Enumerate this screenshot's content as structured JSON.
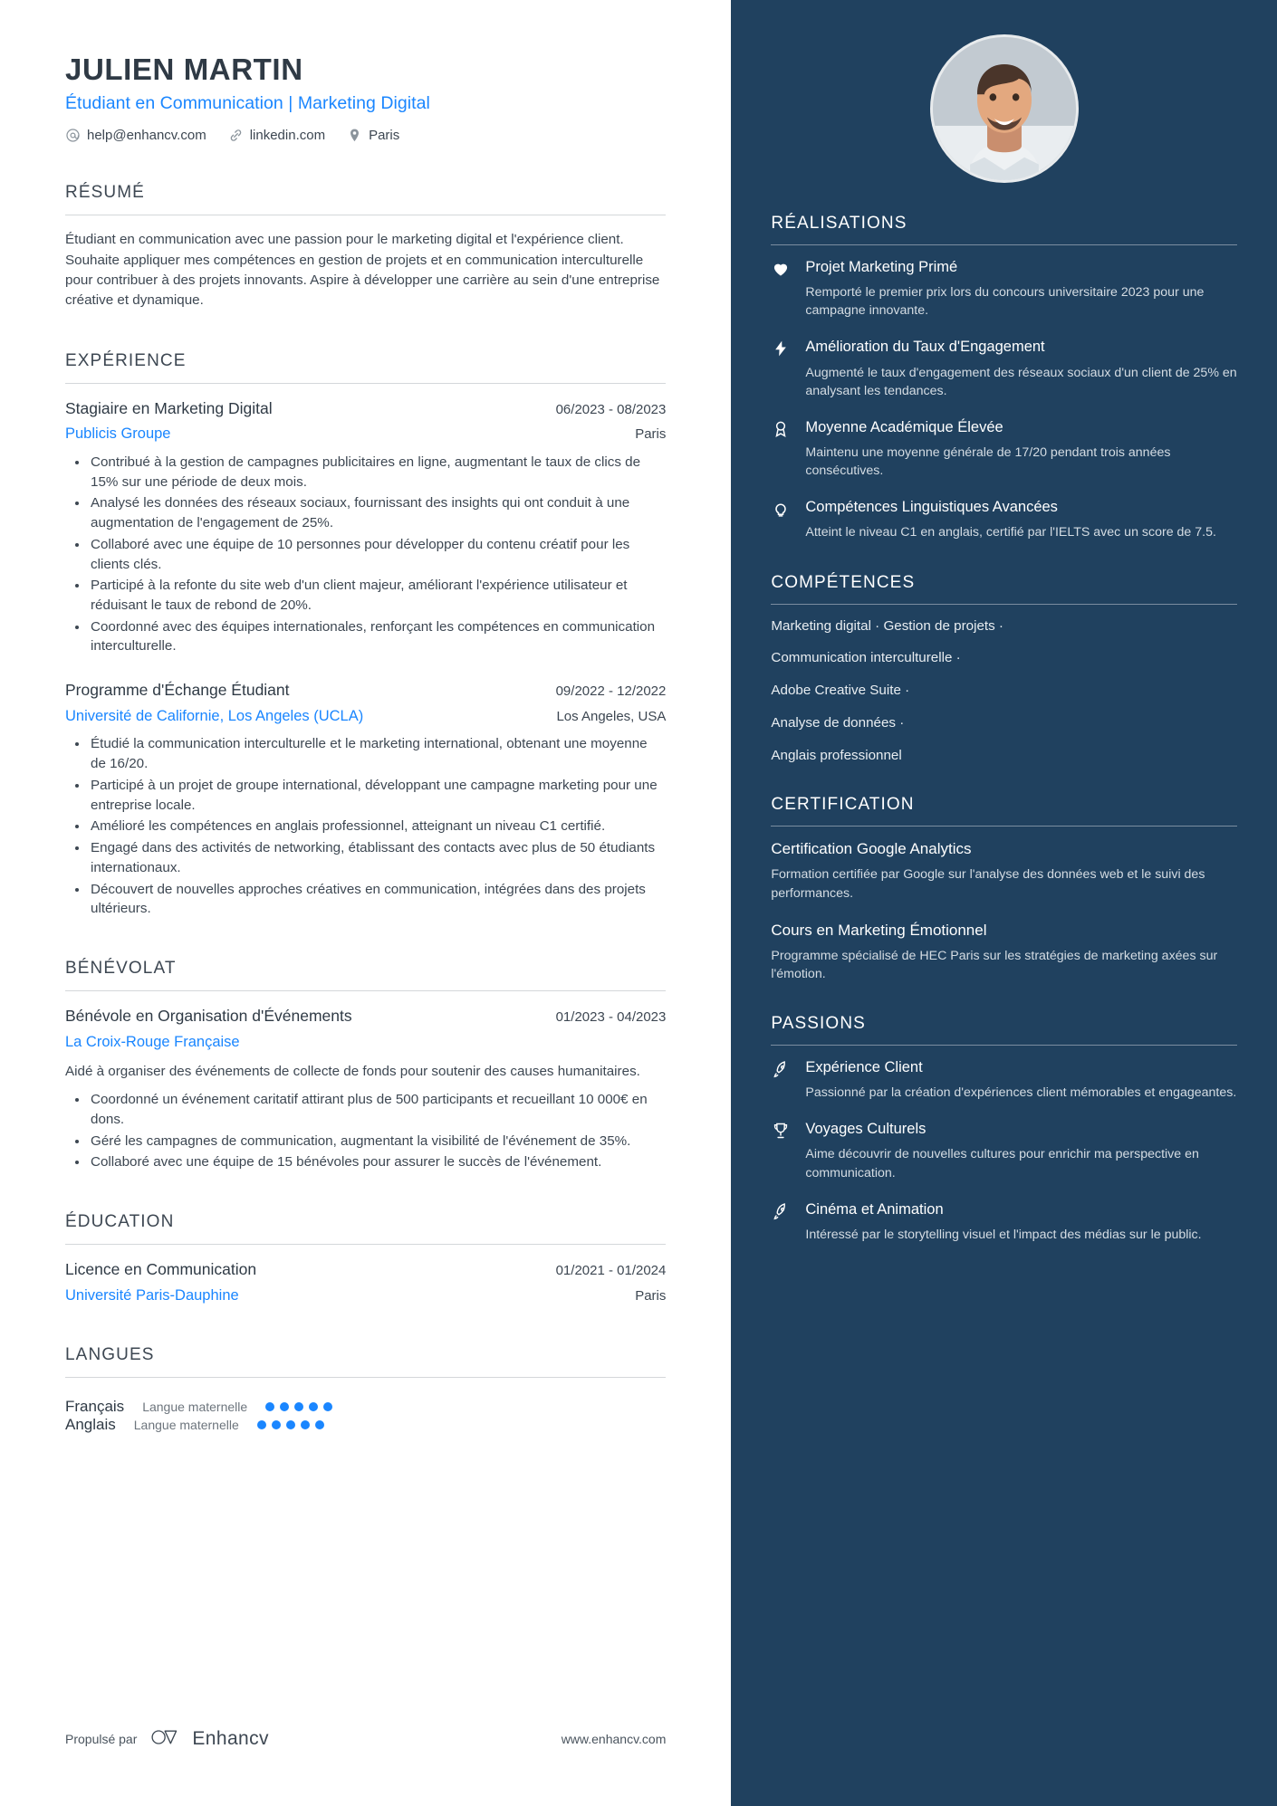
{
  "header": {
    "name": "JULIEN MARTIN",
    "headline": "Étudiant en Communication | Marketing Digital",
    "contacts": [
      {
        "icon": "at-icon",
        "text": "help@enhancv.com"
      },
      {
        "icon": "link-icon",
        "text": "linkedin.com"
      },
      {
        "icon": "location-pin-icon",
        "text": "Paris"
      }
    ]
  },
  "left": {
    "summary": {
      "title": "RÉSUMÉ",
      "text": "Étudiant en communication avec une passion pour le marketing digital et l'expérience client. Souhaite appliquer mes compétences en gestion de projets et en communication interculturelle pour contribuer à des projets innovants. Aspire à développer une carrière au sein d'une entreprise créative et dynamique."
    },
    "experience": {
      "title": "EXPÉRIENCE",
      "entries": [
        {
          "role": "Stagiaire en Marketing Digital",
          "date": "06/2023 - 08/2023",
          "org": "Publicis Groupe",
          "location": "Paris",
          "bullets": [
            "Contribué à la gestion de campagnes publicitaires en ligne, augmentant le taux de clics de 15% sur une période de deux mois.",
            "Analysé les données des réseaux sociaux, fournissant des insights qui ont conduit à une augmentation de l'engagement de 25%.",
            "Collaboré avec une équipe de 10 personnes pour développer du contenu créatif pour les clients clés.",
            "Participé à la refonte du site web d'un client majeur, améliorant l'expérience utilisateur et réduisant le taux de rebond de 20%.",
            "Coordonné avec des équipes internationales, renforçant les compétences en communication interculturelle."
          ]
        },
        {
          "role": "Programme d'Échange Étudiant",
          "date": "09/2022 - 12/2022",
          "org": "Université de Californie, Los Angeles (UCLA)",
          "location": "Los Angeles, USA",
          "bullets": [
            "Étudié la communication interculturelle et le marketing international, obtenant une moyenne de 16/20.",
            "Participé à un projet de groupe international, développant une campagne marketing pour une entreprise locale.",
            "Amélioré les compétences en anglais professionnel, atteignant un niveau C1 certifié.",
            "Engagé dans des activités de networking, établissant des contacts avec plus de 50 étudiants internationaux.",
            "Découvert de nouvelles approches créatives en communication, intégrées dans des projets ultérieurs."
          ]
        }
      ]
    },
    "volunteering": {
      "title": "BÉNÉVOLAT",
      "entries": [
        {
          "role": "Bénévole en Organisation d'Événements",
          "date": "01/2023 - 04/2023",
          "org": "La Croix-Rouge Française",
          "location": "",
          "description": "Aidé à organiser des événements de collecte de fonds pour soutenir des causes humanitaires.",
          "bullets": [
            "Coordonné un événement caritatif attirant plus de 500 participants et recueillant 10 000€ en dons.",
            "Géré les campagnes de communication, augmentant la visibilité de l'événement de 35%.",
            "Collaboré avec une équipe de 15 bénévoles pour assurer le succès de l'événement."
          ]
        }
      ]
    },
    "education": {
      "title": "ÉDUCATION",
      "entries": [
        {
          "role": "Licence en Communication",
          "date": "01/2021 - 01/2024",
          "org": "Université Paris-Dauphine",
          "location": "Paris",
          "bullets": []
        }
      ]
    },
    "languages": {
      "title": "LANGUES",
      "items": [
        {
          "name": "Français",
          "level": "Langue maternelle",
          "dots": 5,
          "total": 5
        },
        {
          "name": "Anglais",
          "level": "Langue maternelle",
          "dots": 5,
          "total": 5
        }
      ]
    }
  },
  "right": {
    "achievements": {
      "title": "RÉALISATIONS",
      "items": [
        {
          "icon": "heart-icon",
          "title": "Projet Marketing Primé",
          "desc": "Remporté le premier prix lors du concours universitaire 2023 pour une campagne innovante."
        },
        {
          "icon": "bolt-icon",
          "title": "Amélioration du Taux d'Engagement",
          "desc": "Augmenté le taux d'engagement des réseaux sociaux d'un client de 25% en analysant les tendances."
        },
        {
          "icon": "award-medal-icon",
          "title": "Moyenne Académique Élevée",
          "desc": "Maintenu une moyenne générale de 17/20 pendant trois années consécutives."
        },
        {
          "icon": "lightbulb-icon",
          "title": "Compétences Linguistiques Avancées",
          "desc": "Atteint le niveau C1 en anglais, certifié par l'IELTS avec un score de 7.5."
        }
      ]
    },
    "skills": {
      "title": "COMPÉTENCES",
      "lines": [
        "Marketing digital · Gestion de projets ·",
        "Communication interculturelle ·",
        "Adobe Creative Suite ·",
        "Analyse de données ·",
        "Anglais professionnel"
      ]
    },
    "certification": {
      "title": "CERTIFICATION",
      "items": [
        {
          "title": "Certification Google Analytics",
          "desc": "Formation certifiée par Google sur l'analyse des données web et le suivi des performances."
        },
        {
          "title": "Cours en Marketing Émotionnel",
          "desc": "Programme spécialisé de HEC Paris sur les stratégies de marketing axées sur l'émotion."
        }
      ]
    },
    "passions": {
      "title": "PASSIONS",
      "items": [
        {
          "icon": "rocket-icon",
          "title": "Expérience Client",
          "desc": "Passionné par la création d'expériences client mémorables et engageantes."
        },
        {
          "icon": "trophy-icon",
          "title": "Voyages Culturels",
          "desc": "Aime découvrir de nouvelles cultures pour enrichir ma perspective en communication."
        },
        {
          "icon": "rocket-icon",
          "title": "Cinéma et Animation",
          "desc": "Intéressé par le storytelling visuel et l'impact des médias sur le public."
        }
      ]
    }
  },
  "footer": {
    "powered_by": "Propulsé par",
    "brand": "Enhancv",
    "website": "www.enhancv.com"
  },
  "colors": {
    "sidebar_bg": "#20415f",
    "accent_blue": "#1a86ff",
    "body_text": "#3d4752",
    "heading_text": "#2f3a45"
  }
}
